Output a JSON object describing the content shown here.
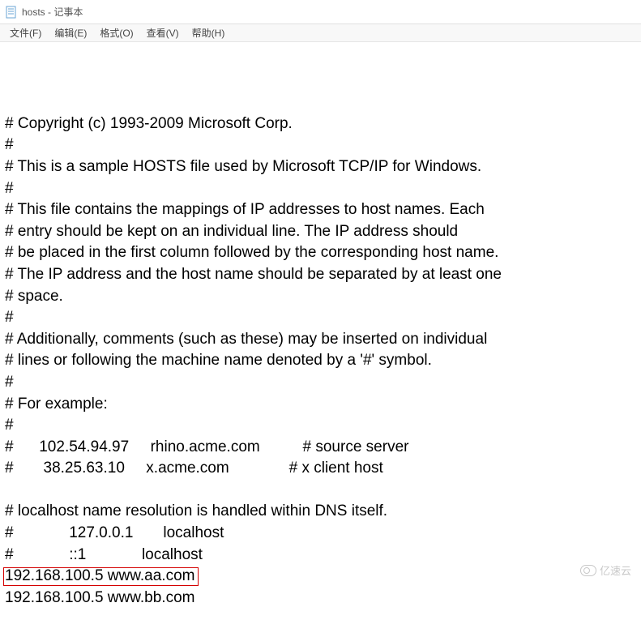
{
  "window": {
    "title": "hosts - 记事本"
  },
  "menu": {
    "file": "文件(F)",
    "edit": "编辑(E)",
    "format": "格式(O)",
    "view": "查看(V)",
    "help": "帮助(H)"
  },
  "content": {
    "lines": [
      "# Copyright (c) 1993-2009 Microsoft Corp.",
      "#",
      "# This is a sample HOSTS file used by Microsoft TCP/IP for Windows.",
      "#",
      "# This file contains the mappings of IP addresses to host names. Each",
      "# entry should be kept on an individual line. The IP address should",
      "# be placed in the first column followed by the corresponding host name.",
      "# The IP address and the host name should be separated by at least one",
      "# space.",
      "#",
      "# Additionally, comments (such as these) may be inserted on individual",
      "# lines or following the machine name denoted by a '#' symbol.",
      "#",
      "# For example:",
      "#",
      "#      102.54.94.97     rhino.acme.com          # source server",
      "#       38.25.63.10     x.acme.com              # x client host",
      "",
      "# localhost name resolution is handled within DNS itself.",
      "#             127.0.0.1       localhost",
      "#             ::1             localhost",
      "192.168.100.5 www.aa.com",
      "192.168.100.5 www.bb.com"
    ],
    "highlighted_line_index": 21
  },
  "watermark": {
    "text": "亿速云"
  }
}
